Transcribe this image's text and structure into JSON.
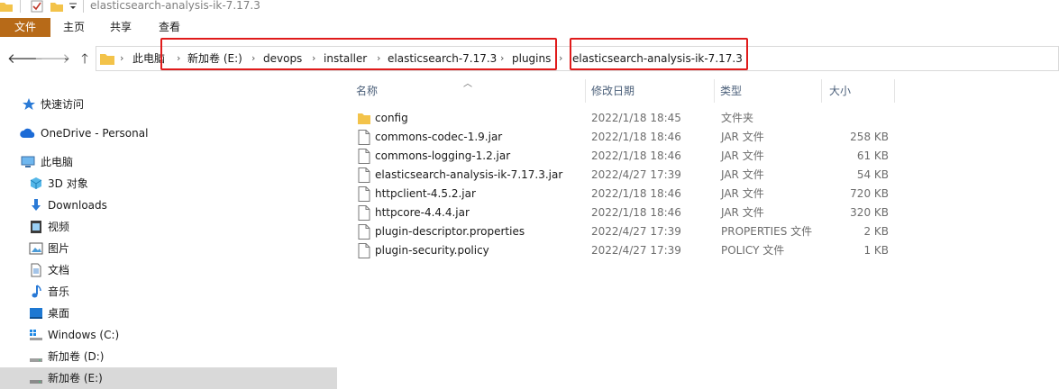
{
  "window": {
    "title": "elasticsearch-analysis-ik-7.17.3"
  },
  "ribbon": {
    "tabs": [
      "文件",
      "主页",
      "共享",
      "查看"
    ]
  },
  "address": {
    "crumbs": [
      "此电脑",
      "新加卷 (E:)",
      "devops",
      "installer",
      "elasticsearch-7.17.3",
      "plugins",
      "elasticsearch-analysis-ik-7.17.3"
    ]
  },
  "sidebar": {
    "items": [
      {
        "label": "快速访问",
        "icon": "star-icon"
      },
      {
        "label": "OneDrive - Personal",
        "icon": "cloud-icon"
      },
      {
        "label": "此电脑",
        "icon": "pc-icon"
      },
      {
        "label": "3D 对象",
        "icon": "cube-icon"
      },
      {
        "label": "Downloads",
        "icon": "download-icon"
      },
      {
        "label": "视频",
        "icon": "video-icon"
      },
      {
        "label": "图片",
        "icon": "picture-icon"
      },
      {
        "label": "文档",
        "icon": "document-icon"
      },
      {
        "label": "音乐",
        "icon": "music-icon"
      },
      {
        "label": "桌面",
        "icon": "desktop-icon"
      },
      {
        "label": "Windows (C:)",
        "icon": "drive-icon"
      },
      {
        "label": "新加卷 (D:)",
        "icon": "drive-icon"
      },
      {
        "label": "新加卷 (E:)",
        "icon": "drive-icon"
      }
    ]
  },
  "columns": {
    "name": "名称",
    "date": "修改日期",
    "type": "类型",
    "size": "大小"
  },
  "files": [
    {
      "name": "config",
      "date": "2022/1/18 18:45",
      "type": "文件夹",
      "size": "",
      "kind": "folder"
    },
    {
      "name": "commons-codec-1.9.jar",
      "date": "2022/1/18 18:46",
      "type": "JAR 文件",
      "size": "258 KB",
      "kind": "file"
    },
    {
      "name": "commons-logging-1.2.jar",
      "date": "2022/1/18 18:46",
      "type": "JAR 文件",
      "size": "61 KB",
      "kind": "file"
    },
    {
      "name": "elasticsearch-analysis-ik-7.17.3.jar",
      "date": "2022/4/27 17:39",
      "type": "JAR 文件",
      "size": "54 KB",
      "kind": "file"
    },
    {
      "name": "httpclient-4.5.2.jar",
      "date": "2022/1/18 18:46",
      "type": "JAR 文件",
      "size": "720 KB",
      "kind": "file"
    },
    {
      "name": "httpcore-4.4.4.jar",
      "date": "2022/1/18 18:46",
      "type": "JAR 文件",
      "size": "320 KB",
      "kind": "file"
    },
    {
      "name": "plugin-descriptor.properties",
      "date": "2022/4/27 17:39",
      "type": "PROPERTIES 文件",
      "size": "2 KB",
      "kind": "file"
    },
    {
      "name": "plugin-security.policy",
      "date": "2022/4/27 17:39",
      "type": "POLICY 文件",
      "size": "1 KB",
      "kind": "file"
    }
  ],
  "colors": {
    "file_tab": "#b76a18",
    "highlight": "#e01b1b",
    "folder": "#f3c34a",
    "selected": "#d9d9d9"
  }
}
